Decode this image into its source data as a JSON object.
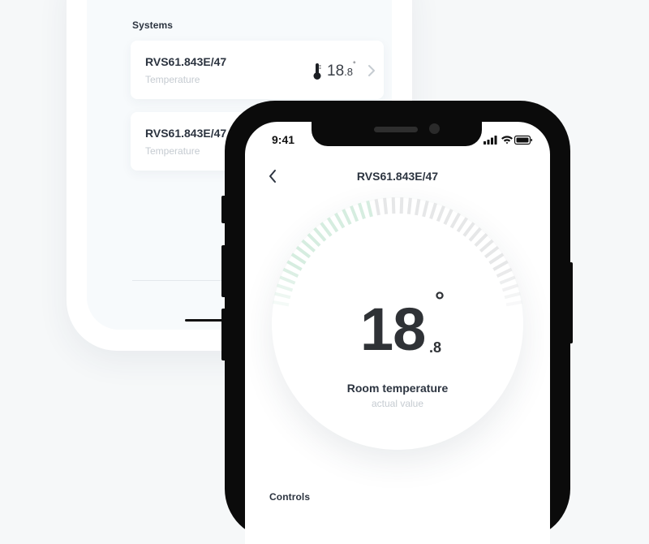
{
  "background_screen": {
    "section_title": "Systems",
    "systems": [
      {
        "name": "RVS61.843E/47",
        "type": "Temperature",
        "temp_int": "18",
        "temp_dec": ".8",
        "temp_deg": "°",
        "icon": "thermometer-icon"
      },
      {
        "name": "RVS61.843E/47",
        "type": "Temperature"
      }
    ]
  },
  "status_bar": {
    "time": "9:41",
    "icons": [
      "signal-icon",
      "wifi-icon",
      "battery-icon"
    ]
  },
  "header": {
    "title": "RVS61.843E/47",
    "back_icon": "chevron-left-icon"
  },
  "dial": {
    "value_int": "18",
    "value_dec": ".8",
    "degree": "°",
    "label": "Room temperature",
    "sublabel": "actual value",
    "level_fraction": 0.1
  },
  "controls": {
    "section_title": "Controls"
  },
  "colors": {
    "text_dark": "#2c3440",
    "text_muted": "#c5cbd1",
    "accent_green": "#d6ede0",
    "tick_gray": "#e6e7e8",
    "phone_frame": "#0b0b0b"
  }
}
